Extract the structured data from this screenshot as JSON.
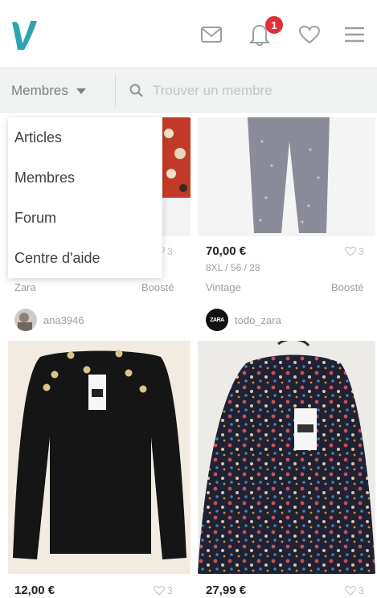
{
  "header": {
    "notification_count": "1",
    "colors": {
      "brand": "#2ba5b3",
      "badge": "#e0313a"
    }
  },
  "search": {
    "segment_label": "Membres",
    "placeholder": "Trouver un membre"
  },
  "dropdown": {
    "items": [
      "Articles",
      "Membres",
      "Forum",
      "Centre d'aide"
    ]
  },
  "items": [
    {
      "likes": "3",
      "brand": "Zara",
      "boost": "Boosté",
      "username": "ana3946"
    },
    {
      "price": "70,00 €",
      "size": "8XL / 56 / 28",
      "likes": "3",
      "brand": "Vintage",
      "boost": "Boosté",
      "username": "todo_zara",
      "avatar_text": "ZARA"
    },
    {
      "price": "12,00 €",
      "likes": "3"
    },
    {
      "price": "27,99 €",
      "likes": "3"
    }
  ]
}
